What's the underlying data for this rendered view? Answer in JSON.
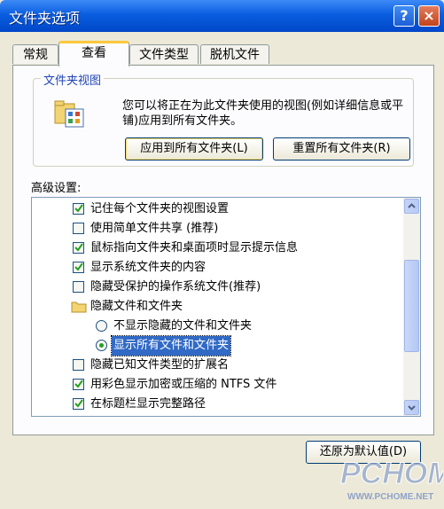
{
  "window": {
    "title": "文件夹选项",
    "help_label": "?",
    "close_label": "×"
  },
  "tabs": [
    {
      "label": "常规",
      "active": false
    },
    {
      "label": "查看",
      "active": true
    },
    {
      "label": "文件类型",
      "active": false
    },
    {
      "label": "脱机文件",
      "active": false
    }
  ],
  "folder_views": {
    "legend": "文件夹视图",
    "description": "您可以将正在为此文件夹使用的视图(例如详细信息或平铺)应用到所有文件夹。",
    "apply_label": "应用到所有文件夹(L)",
    "reset_label": "重置所有文件夹(R)"
  },
  "advanced": {
    "label": "高级设置:",
    "items": [
      {
        "type": "checkbox",
        "checked": true,
        "label": "记住每个文件夹的视图设置"
      },
      {
        "type": "checkbox",
        "checked": false,
        "label": "使用简单文件共享 (推荐)"
      },
      {
        "type": "checkbox",
        "checked": true,
        "label": "鼠标指向文件夹和桌面项时显示提示信息"
      },
      {
        "type": "checkbox",
        "checked": true,
        "label": "显示系统文件夹的内容"
      },
      {
        "type": "checkbox",
        "checked": false,
        "label": "隐藏受保护的操作系统文件(推荐)"
      },
      {
        "type": "folder",
        "label": "隐藏文件和文件夹"
      },
      {
        "type": "radio",
        "checked": false,
        "label": "不显示隐藏的文件和文件夹"
      },
      {
        "type": "radio",
        "checked": true,
        "label": "显示所有文件和文件夹"
      },
      {
        "type": "checkbox",
        "checked": false,
        "label": "隐藏已知文件类型的扩展名"
      },
      {
        "type": "checkbox",
        "checked": true,
        "label": "用彩色显示加密或压缩的 NTFS 文件"
      },
      {
        "type": "checkbox",
        "checked": true,
        "label": "在标题栏显示完整路径"
      }
    ]
  },
  "restore_label": "还原为默认值(D)",
  "watermark": {
    "brand": "PCHOME",
    "url": "WWW.PCHOME.NET"
  },
  "colors": {
    "titlebar": "#0a5ee0",
    "legend_text": "#1f45b5",
    "selection": "#316ac5",
    "check_mark": "#21a121",
    "watermark": "#8fa3c8"
  }
}
